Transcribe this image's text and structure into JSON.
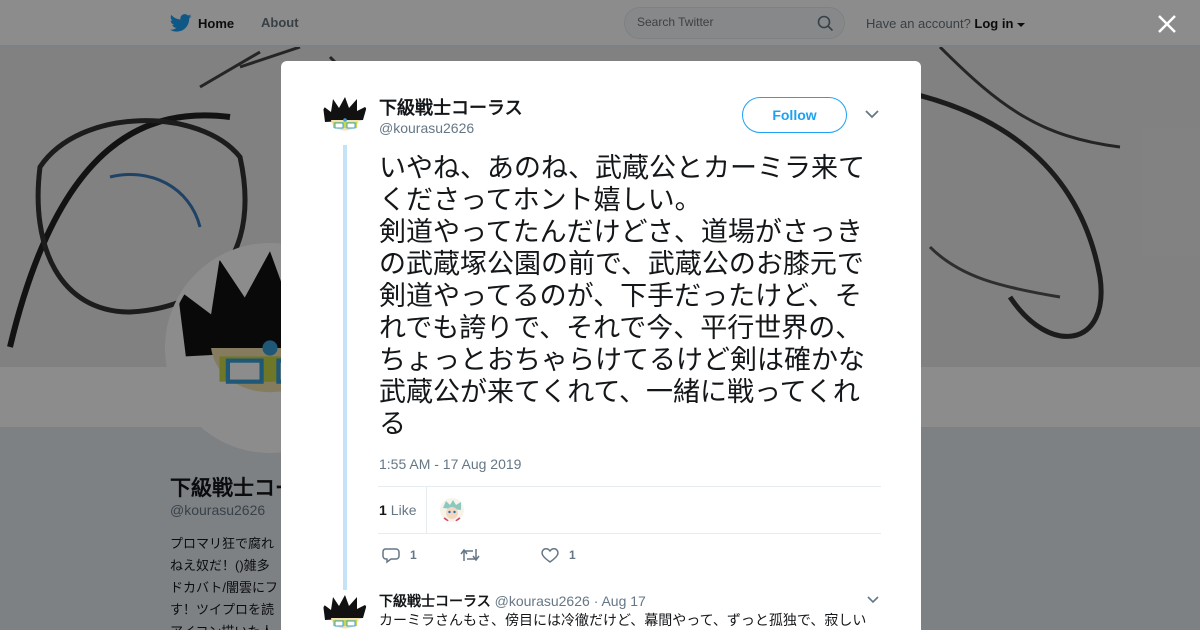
{
  "nav": {
    "home_label": "Home",
    "about_label": "About",
    "search_placeholder": "Search Twitter",
    "account_prompt": "Have an account?",
    "login_label": "Log in"
  },
  "profile": {
    "name": "下級戦士コーラス",
    "handle": "@kourasu2626",
    "bio_lines": [
      "プロマリ狂で腐れ",
      "ねえ奴だ！()雑多",
      "ドカバト/闇雲にフ",
      "す！ツイプロを読",
      "アイコン描いた人"
    ]
  },
  "tweet": {
    "author_name": "下級戦士コーラス",
    "author_handle": "@kourasu2626",
    "follow_label": "Follow",
    "text": "いやね、あのね、武蔵公とカーミラ来てくださってホント嬉しい。\n剣道やってたんだけどさ、道場がさっきの武蔵塚公園の前で、武蔵公のお膝元で剣道やってるのが、下手だったけど、それでも誇りで、それで今、平行世界の、ちょっとおちゃらけてるけど剣は確かな武蔵公が来てくれて、一緒に戦ってくれる",
    "timestamp": "1:55 AM - 17 Aug 2019",
    "like_count": "1",
    "like_label": "Like",
    "actions": {
      "reply_count": "1",
      "retweet_count": "",
      "like_count": "1"
    }
  },
  "reply": {
    "author_name": "下級戦士コーラス",
    "author_handle": "@kourasu2626",
    "date": "· Aug 17",
    "text": "カーミラさんもさ、傍目には冷徹だけど、幕間やって、ずっと孤独で、寂しい"
  },
  "colors": {
    "accent": "#1da1f2",
    "thread_line": "#c4e3f9",
    "secondary_text": "#657786"
  }
}
